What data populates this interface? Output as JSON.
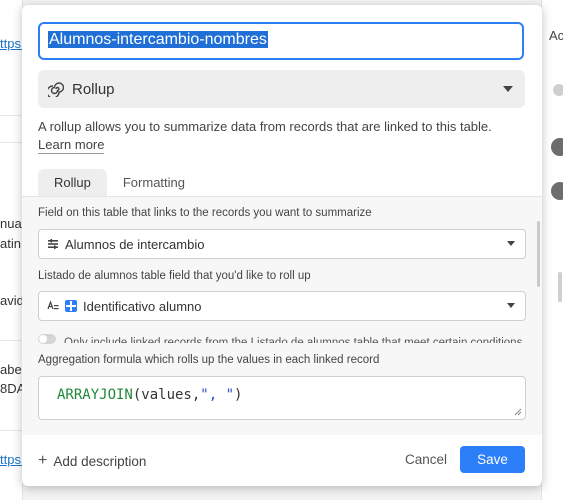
{
  "background": {
    "left_fragments": [
      "ttps:",
      "nual",
      "atin",
      "avid",
      "abel",
      "8DA",
      "ttps:"
    ],
    "right_header": "Ac"
  },
  "dialog": {
    "field_name": "Alumnos-intercambio-nombres",
    "field_type": "Rollup",
    "description": "A rollup allows you to summarize data from records that are linked to this table.",
    "learn_more": "Learn more",
    "tabs": [
      "Rollup",
      "Formatting"
    ],
    "link_field_label": "Field on this table that links to the records you want to summarize",
    "link_field_value": "Alumnos de intercambio",
    "rollup_field_label": "Listado de alumnos table field that you'd like to roll up",
    "rollup_field_value": "Identificativo alumno",
    "condition_toggle_label": "Only include linked records from the Listado de alumnos table that meet certain conditions",
    "aggregation_label": "Aggregation formula which rolls up the values in each linked record",
    "formula": {
      "fn": "ARRAYJOIN",
      "open": "(values,",
      "str": "\", \"",
      "close": ")"
    },
    "add_description": "Add description",
    "cancel": "Cancel",
    "save": "Save"
  },
  "colors": {
    "accent": "#2d7ff9",
    "formula_function": "#20883a",
    "formula_string": "#2a4fcf"
  }
}
